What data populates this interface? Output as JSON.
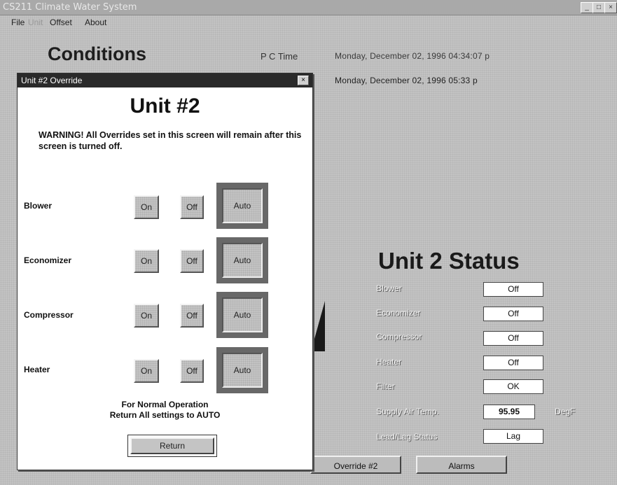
{
  "window": {
    "title": "CS211 Climate Water System",
    "minimize": "_",
    "maximize": "□",
    "close": "×"
  },
  "menu": {
    "file": "File",
    "unit": "Unit",
    "offset": "Offset",
    "about": "About"
  },
  "main": {
    "heading": "Conditions",
    "pc_time_label": "P C Time",
    "pc_time_value": "Monday, December 02, 1996  04:34:07 p",
    "system_time_value": "Monday, December 02, 1996  05:33    p"
  },
  "status": {
    "heading": "Unit 2 Status",
    "rows": [
      {
        "label": "Blower",
        "value": "Off"
      },
      {
        "label": "Economizer",
        "value": "Off"
      },
      {
        "label": "Compressor",
        "value": "Off"
      },
      {
        "label": "Heater",
        "value": "Off"
      },
      {
        "label": "Filter",
        "value": "OK"
      },
      {
        "label": "Supply Air Temp.",
        "value": "95.95"
      },
      {
        "label": "Lead/Lag Status",
        "value": "Lag"
      }
    ],
    "temp_unit": "DegF"
  },
  "bottom": {
    "override2": "Override #2",
    "alarms": "Alarms"
  },
  "dialog": {
    "title": "Unit #2 Override",
    "close": "×",
    "heading": "Unit #2",
    "warning": "WARNING!  All Overrides set in this screen will remain after this screen is turned off.",
    "on_label": "On",
    "off_label": "Off",
    "auto_label": "Auto",
    "rows": [
      {
        "label": "Blower"
      },
      {
        "label": "Economizer"
      },
      {
        "label": "Compressor"
      },
      {
        "label": "Heater"
      }
    ],
    "normal_line1": "For Normal Operation",
    "normal_line2": "Return All settings to AUTO",
    "return_label": "Return"
  }
}
